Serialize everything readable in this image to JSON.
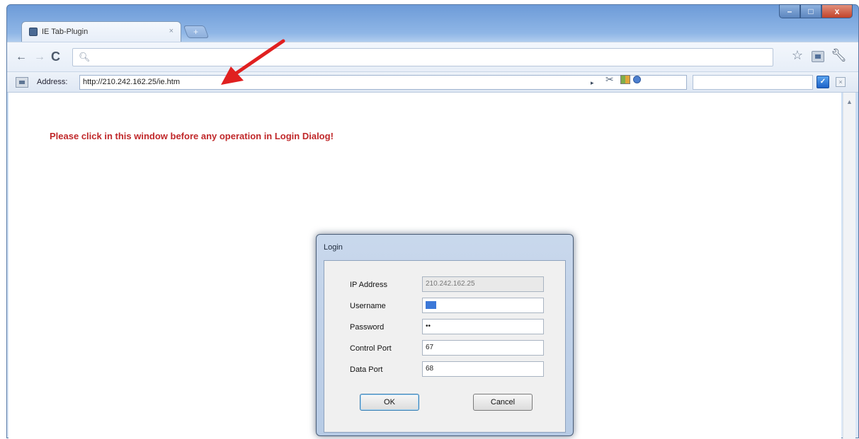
{
  "browser": {
    "tab_title": "IE Tab-Plugin",
    "tab_close": "×",
    "new_tab": "+",
    "window_controls": {
      "minimize": "–",
      "maximize": "□",
      "close": "x"
    },
    "nav": {
      "back": "←",
      "forward": "→",
      "reload": "C",
      "omnibox_value": ""
    },
    "icons": [
      "search-icon",
      "star-icon",
      "extension-icon",
      "wrench-icon"
    ]
  },
  "address_bar": {
    "label": "Address:",
    "url": "http://210.242.162.25/ie.htm",
    "go_icon": "▸",
    "search_value": ""
  },
  "page": {
    "notice": "Please click in this window before any operation in Login Dialog!"
  },
  "login_dialog": {
    "title": "Login",
    "fields": {
      "ip": {
        "label": "IP Address",
        "value": "210.242.162.25"
      },
      "username": {
        "label": "Username",
        "value": ""
      },
      "password": {
        "label": "Password",
        "value": "••"
      },
      "control_port": {
        "label": "Control Port",
        "value": "67"
      },
      "data_port": {
        "label": "Data Port",
        "value": "68"
      }
    },
    "ok_label": "OK",
    "cancel_label": "Cancel"
  },
  "colors": {
    "notice": "#c0282a",
    "arrow": "#e02020",
    "frame": "#8fb6e6"
  }
}
